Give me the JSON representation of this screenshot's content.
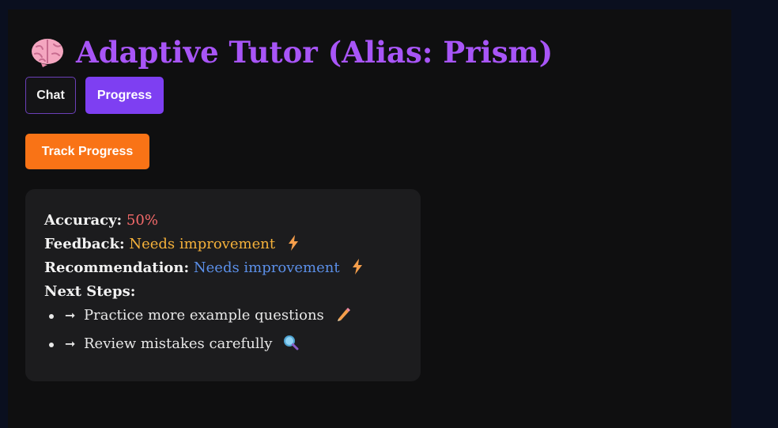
{
  "header": {
    "title": "Adaptive Tutor (Alias: Prism)",
    "icon": "brain-icon"
  },
  "tabs": [
    {
      "label": "Chat",
      "active": false
    },
    {
      "label": "Progress",
      "active": true
    }
  ],
  "actions": {
    "track_progress_label": "Track Progress"
  },
  "progress": {
    "accuracy_label": "Accuracy:",
    "accuracy_value": "50%",
    "feedback_label": "Feedback:",
    "feedback_value": "Needs improvement",
    "recommendation_label": "Recommendation:",
    "recommendation_value": "Needs improvement",
    "next_steps_label": "Next Steps:",
    "next_steps": [
      {
        "arrow": "➞",
        "text": "Practice more example questions",
        "icon": "pencil-icon"
      },
      {
        "arrow": "➞",
        "text": "Review mistakes carefully",
        "icon": "magnifier-icon"
      }
    ]
  },
  "colors": {
    "title": "#a855f7",
    "active_tab": "#7e3ff2",
    "track_button": "#f97316",
    "accuracy": "#f46a6a",
    "feedback": "#f5b13a",
    "recommendation": "#5b8fe8"
  }
}
